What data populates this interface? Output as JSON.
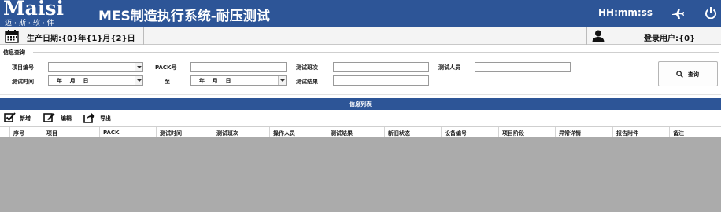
{
  "app": {
    "logo_text": "Maisi",
    "logo_subtext": "迈·斯·软·件",
    "title": "MES制造执行系统-耐压测试",
    "clock": "HH:mm:ss"
  },
  "infobar": {
    "production_date": "生产日期:{0}年{1}月{2}日",
    "login_user": "登录用户:{0}"
  },
  "query": {
    "section_title": "信息查询",
    "project_no_label": "项目编号",
    "pack_no_label": "PACK号",
    "test_batch_label": "测试班次",
    "tester_label": "测试人员",
    "test_time_label": "测试时间",
    "to_label": "至",
    "test_result_label": "测试结果",
    "date_from_value": "年    月    日",
    "date_to_value": "年    月    日",
    "search_button": "查询"
  },
  "list": {
    "title": "信息列表",
    "toolbar": {
      "add": "新增",
      "edit": "编辑",
      "export": "导出"
    },
    "columns": [
      "序号",
      "项目",
      "PACK",
      "测试时间",
      "测试班次",
      "操作人员",
      "测试结果",
      "新旧状态",
      "设备编号",
      "项目阶段",
      "异常详情",
      "报告附件",
      "备注"
    ]
  },
  "colors": {
    "brand_blue": "#2d5597",
    "grid_empty": "#ababab"
  }
}
